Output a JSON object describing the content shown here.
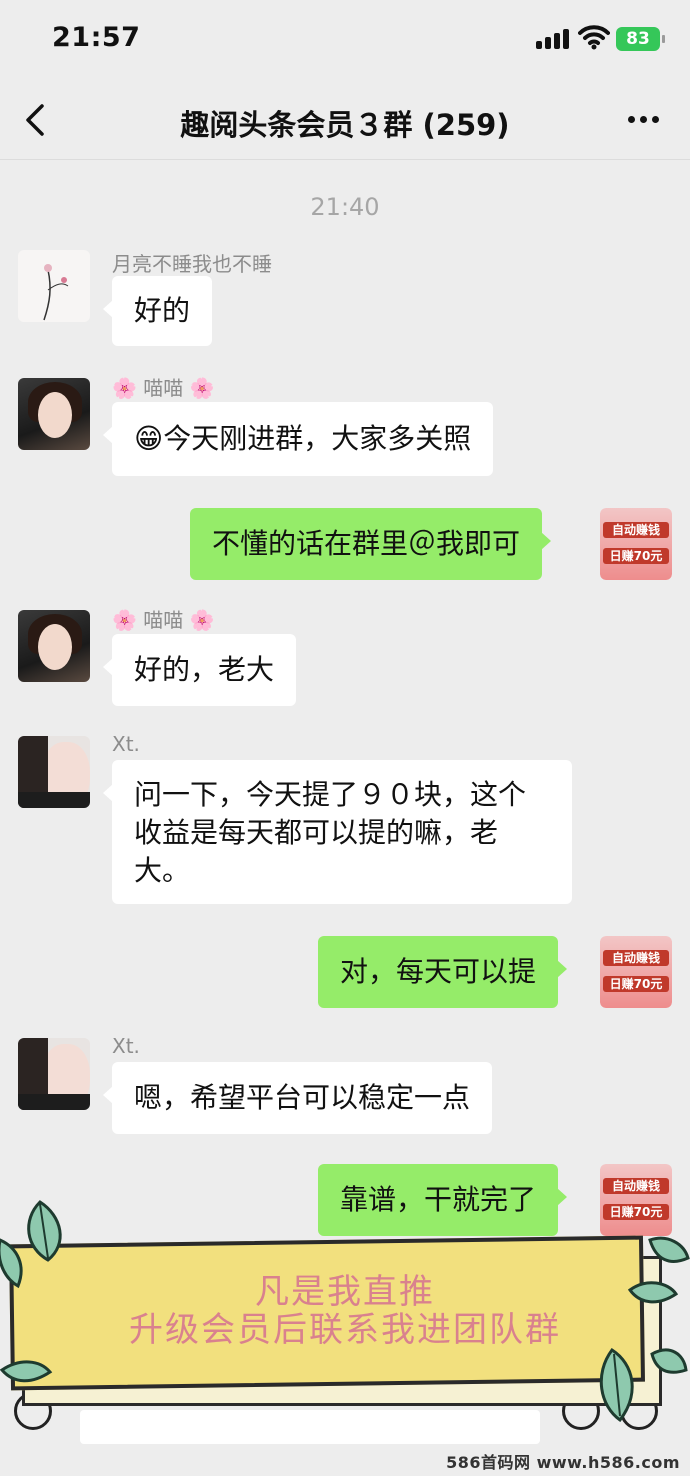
{
  "status_bar": {
    "time": "21:57",
    "battery": "83"
  },
  "header": {
    "title": "趣阅头条会员３群 (259)"
  },
  "timestamp": "21:40",
  "messages": [
    {
      "direction": "in",
      "sender": "月亮不睡我也不睡",
      "text": "好的"
    },
    {
      "direction": "in",
      "sender": "🌸 喵喵 🌸",
      "text": "😁今天刚进群，大家多关照"
    },
    {
      "direction": "out",
      "text": "不懂的话在群里＠我即可"
    },
    {
      "direction": "in",
      "sender": "🌸 喵喵 🌸",
      "text": "好的，老大"
    },
    {
      "direction": "in",
      "sender": "Xt.",
      "lines": [
        "问一下，今天提了９０块，这个",
        "收益是每天都可以提的嘛，老",
        "大。"
      ]
    },
    {
      "direction": "out",
      "text": "对，每天可以提"
    },
    {
      "direction": "in",
      "sender": "Xt.",
      "text": "嗯，希望平台可以稳定一点"
    },
    {
      "direction": "out",
      "text": "靠谱，干就完了"
    }
  ],
  "self_avatar": {
    "line1": "自动赚钱",
    "line2": "日赚70元"
  },
  "banner": {
    "line1": "凡是我直推",
    "line2": "升级会员后联系我进团队群"
  },
  "watermark": "586首码网 www.h586.com",
  "colors": {
    "background": "#ededed",
    "outgoing_bubble": "#95ec69",
    "incoming_bubble": "#ffffff",
    "banner": "#f2e07e",
    "banner_text": "#d9818e"
  }
}
